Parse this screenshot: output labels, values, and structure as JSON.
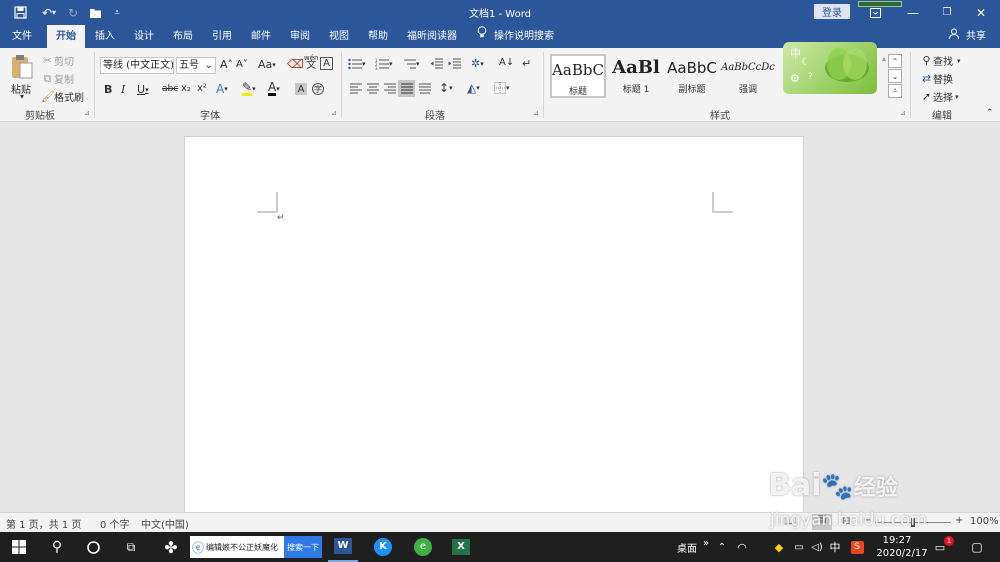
{
  "titlebar": {
    "title": "文档1 - Word",
    "login_label": "登录",
    "save_icon": "save-icon",
    "undo_icon": "undo-icon",
    "redo_icon": "redo-icon",
    "open_icon": "open-folder-icon",
    "customize_icon": "customize-quick-access-icon"
  },
  "tabs": [
    "文件",
    "开始",
    "插入",
    "设计",
    "布局",
    "引用",
    "邮件",
    "审阅",
    "视图",
    "帮助",
    "福昕阅读器"
  ],
  "active_tab": "开始",
  "tell_me": "操作说明搜索",
  "share_label": "共享",
  "clipboard": {
    "paste_label": "粘贴",
    "cut_label": "剪切",
    "copy_label": "复制",
    "format_painter_label": "格式刷",
    "group_label": "剪贴板"
  },
  "font": {
    "font_name": "等线 (中文正文)",
    "font_size": "五号",
    "group_label": "字体",
    "bold": "B",
    "italic": "I",
    "underline": "U",
    "strike": "abc",
    "subscript": "x₂",
    "superscript": "x²",
    "grow": "A˄",
    "shrink": "A˅",
    "case": "Aa",
    "pinyin_top": "wén",
    "pinyin_bottom": "文",
    "border_char": "A"
  },
  "paragraph": {
    "group_label": "段落"
  },
  "styles": {
    "group_label": "样式",
    "items": [
      {
        "sample": "AaBbC",
        "name": "标题"
      },
      {
        "sample": "AaBl",
        "name": "标题 1"
      },
      {
        "sample": "AaBbC",
        "name": "副标题"
      },
      {
        "sample": "AaBbCcDc",
        "name": "强调"
      }
    ]
  },
  "ime_widget": {
    "char": "中"
  },
  "editing": {
    "group_label": "编辑",
    "find_label": "查找",
    "replace_label": "替换",
    "select_label": "选择"
  },
  "statusbar": {
    "page_info": "第 1 页，共 1 页",
    "word_count": "0 个字",
    "language": "中文(中国)",
    "zoom": "100%"
  },
  "taskbar": {
    "search_text": "编辑嫉不公正妖魔化",
    "search_button": "搜索一下",
    "desktop_label": "桌面",
    "ime_char": "中",
    "time": "19:27",
    "date": "2020/2/17",
    "notification_count": "1"
  },
  "watermark": {
    "brand": "Bai",
    "brand_suffix": "经验",
    "url": "jingyan.baidu.com"
  },
  "colors": {
    "accent": "#2b579a",
    "taskbar": "#1f1f1f",
    "ribbon": "#f3f3f3",
    "canvas": "#e6e6e6"
  }
}
